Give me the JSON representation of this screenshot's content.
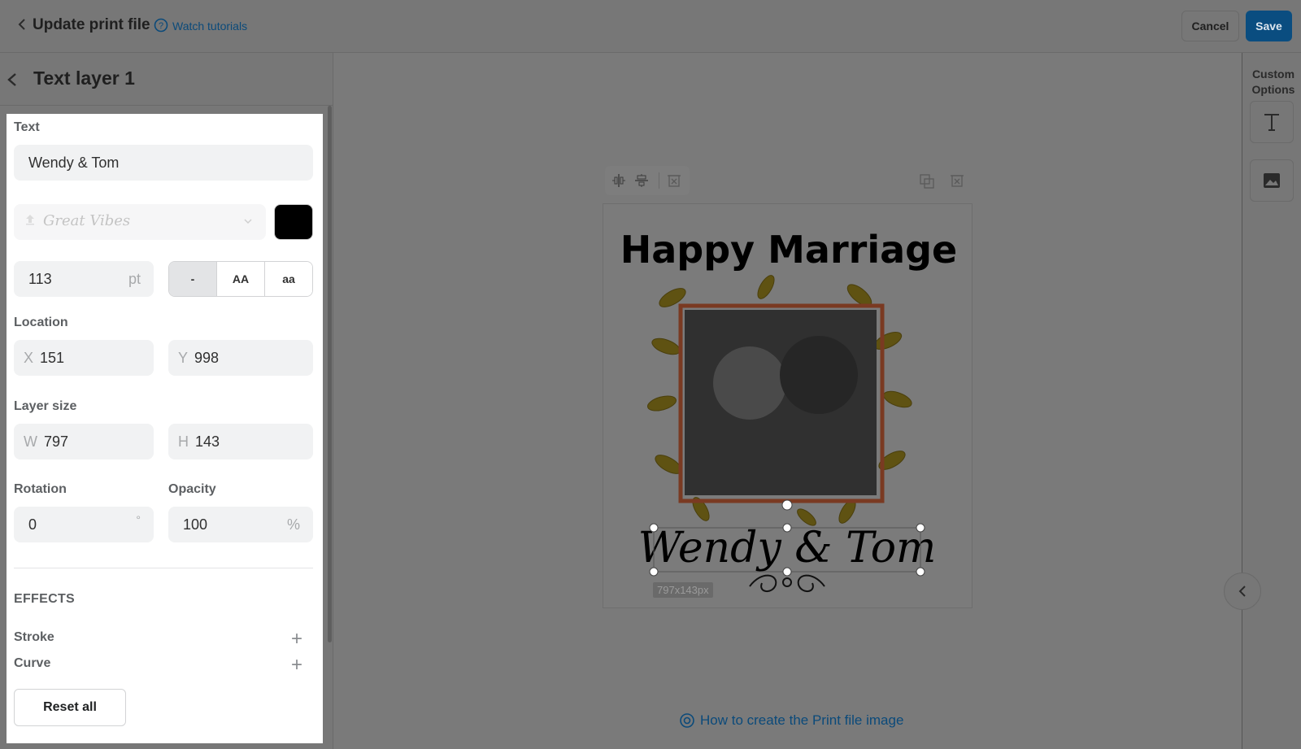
{
  "header": {
    "title": "Update print file",
    "tutorials_label": "Watch tutorials",
    "cancel_label": "Cancel",
    "save_label": "Save"
  },
  "panel": {
    "layer_title": "Text layer 1",
    "text_label": "Text",
    "text_value": "Wendy & Tom",
    "font_preview": "Great Vibes",
    "font_color": "#000000",
    "font_size": "113",
    "font_size_unit": "pt",
    "case_options": [
      "-",
      "AA",
      "aa"
    ],
    "location_label": "Location",
    "x_prefix": "X",
    "x_value": "151",
    "y_prefix": "Y",
    "y_value": "998",
    "layer_size_label": "Layer size",
    "w_prefix": "W",
    "w_value": "797",
    "h_prefix": "H",
    "h_value": "143",
    "rotation_label": "Rotation",
    "rotation_value": "0",
    "rotation_unit": "°",
    "opacity_label": "Opacity",
    "opacity_value": "100",
    "opacity_unit": "%",
    "effects_label": "EFFECTS",
    "stroke_label": "Stroke",
    "curve_label": "Curve",
    "reset_label": "Reset all"
  },
  "canvas": {
    "headline": "Happy Marriage",
    "names": "Wendy & Tom",
    "layer_dims": "797x143px"
  },
  "footer": {
    "help_link": "How to create the Print file image"
  },
  "rail": {
    "custom_options_label": "Custom Options"
  }
}
